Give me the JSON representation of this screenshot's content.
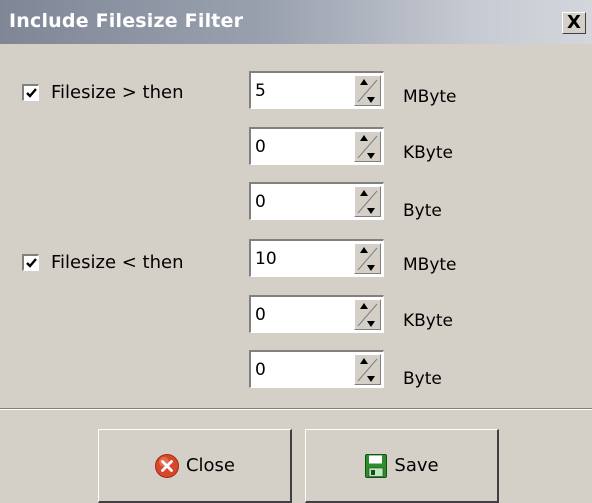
{
  "window": {
    "title": "Include Filesize Filter",
    "close_glyph": "X"
  },
  "greater": {
    "checked": true,
    "label": "Filesize > then",
    "fields": [
      {
        "value": "5",
        "unit": "MByte"
      },
      {
        "value": "0",
        "unit": "KByte"
      },
      {
        "value": "0",
        "unit": "Byte"
      }
    ]
  },
  "less": {
    "checked": true,
    "label": "Filesize < then",
    "fields": [
      {
        "value": "10",
        "unit": "MByte"
      },
      {
        "value": "0",
        "unit": "KByte"
      },
      {
        "value": "0",
        "unit": "Byte"
      }
    ]
  },
  "buttons": {
    "close_label": "Close",
    "close_icon": "close-circle-icon",
    "save_label": "Save",
    "save_icon": "floppy-disk-icon"
  },
  "colors": {
    "window_bg": "#d4d0c8",
    "close_icon": "#d8472a",
    "save_icon": "#2e8b2e"
  }
}
